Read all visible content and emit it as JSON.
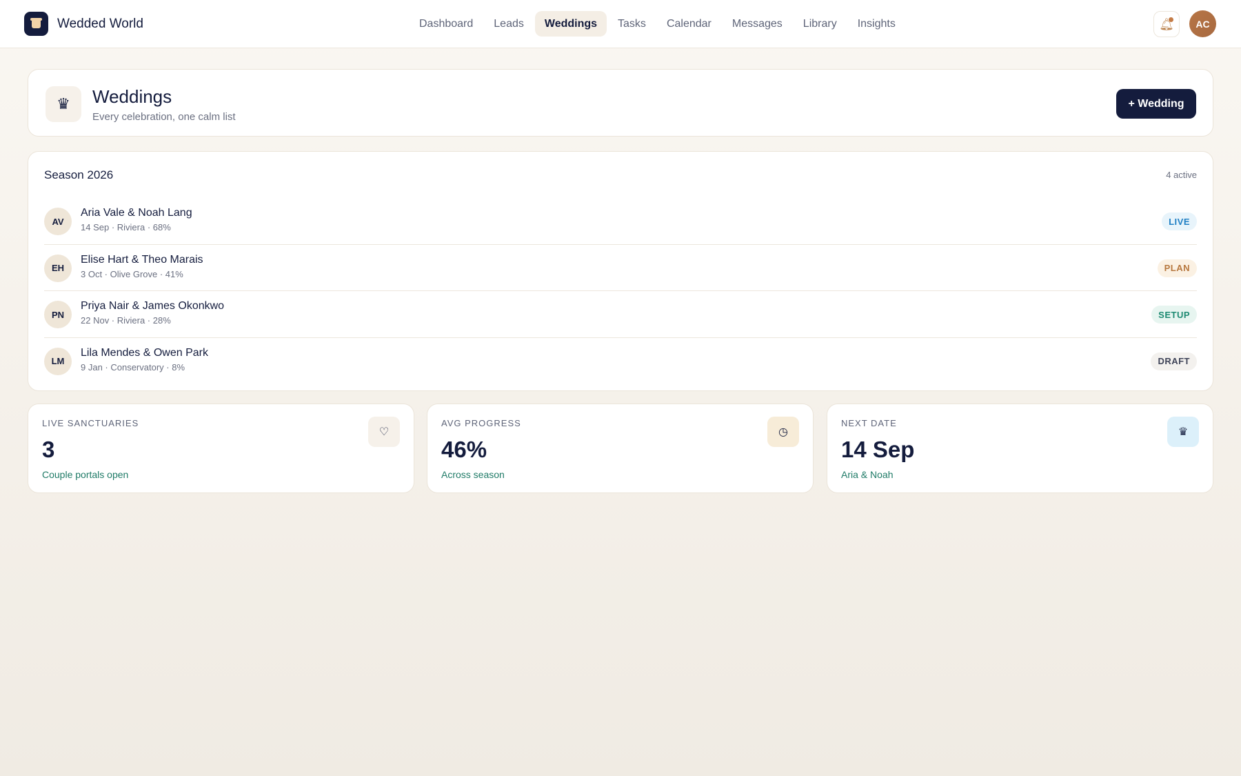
{
  "brand": {
    "name": "Wedded World",
    "logo_icon": "cake-icon"
  },
  "nav": {
    "items": [
      {
        "label": "Dashboard",
        "active": false
      },
      {
        "label": "Leads",
        "active": false
      },
      {
        "label": "Weddings",
        "active": true
      },
      {
        "label": "Tasks",
        "active": false
      },
      {
        "label": "Calendar",
        "active": false
      },
      {
        "label": "Messages",
        "active": false
      },
      {
        "label": "Library",
        "active": false
      },
      {
        "label": "Insights",
        "active": false
      }
    ]
  },
  "user": {
    "initials": "AC",
    "notifications_icon": "bell-icon"
  },
  "page": {
    "title": "Weddings",
    "subtitle": "Every celebration, one calm list",
    "icon": "crown-icon",
    "add_button": "+ Wedding"
  },
  "season": {
    "title": "Season 2026",
    "count": "4 active",
    "weddings": [
      {
        "initials": "AV",
        "name": "Aria Vale & Noah Lang",
        "meta": "14 Sep · Riviera · 68%",
        "status": "LIVE",
        "status_color": "#1f7fc4",
        "status_bg": "#e8f4fb"
      },
      {
        "initials": "EH",
        "name": "Elise Hart & Theo Marais",
        "meta": "3 Oct · Olive Grove · 41%",
        "status": "PLAN",
        "status_color": "#b7783f",
        "status_bg": "#fbf1e3"
      },
      {
        "initials": "PN",
        "name": "Priya Nair & James Okonkwo",
        "meta": "22 Nov · Riviera · 28%",
        "status": "SETUP",
        "status_color": "#1e8a72",
        "status_bg": "#e7f5f0"
      },
      {
        "initials": "LM",
        "name": "Lila Mendes & Owen Park",
        "meta": "9 Jan · Conservatory · 8%",
        "status": "DRAFT",
        "status_color": "#3f4458",
        "status_bg": "#f3f1ee"
      }
    ]
  },
  "stats": [
    {
      "label": "LIVE SANCTUARIES",
      "value": "3",
      "note": "Couple portals open",
      "icon": "heart-icon",
      "icon_bg": "#f6f1ea"
    },
    {
      "label": "AVG PROGRESS",
      "value": "46%",
      "note": "Across season",
      "icon": "clock-icon",
      "icon_bg": "#f7ecd8"
    },
    {
      "label": "NEXT DATE",
      "value": "14 Sep",
      "note": "Aria & Noah",
      "icon": "crown-icon",
      "icon_bg": "#dcf0fa"
    }
  ]
}
